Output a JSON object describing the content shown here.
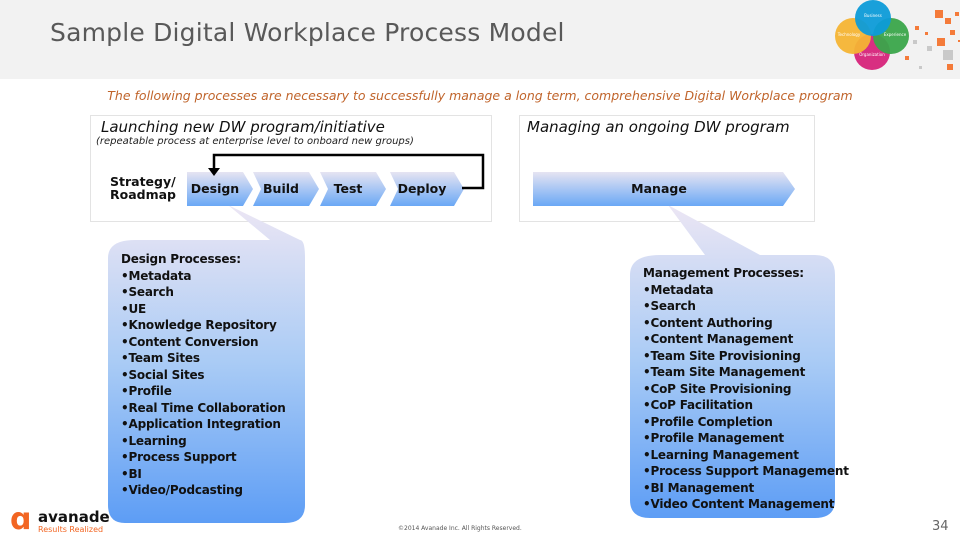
{
  "header": {
    "title": "Sample Digital Workplace Process Model",
    "venn_labels": [
      "Business",
      "Technology",
      "Experience",
      "Organization"
    ]
  },
  "subtitle": "The following processes are necessary to successfully manage a long term, comprehensive Digital Workplace program",
  "launch_panel": {
    "title": "Launching new DW program/initiative",
    "subtitle": "(repeatable process at enterprise level to onboard new groups)",
    "strategy_line1": "Strategy/",
    "strategy_line2": "Roadmap",
    "steps": [
      "Design",
      "Build",
      "Test",
      "Deploy"
    ]
  },
  "manage_panel": {
    "title": "Managing an ongoing DW program",
    "step": "Manage"
  },
  "design_callout": {
    "heading": "Design Processes:",
    "items": [
      "Metadata",
      "Search",
      "UE",
      "Knowledge Repository",
      "Content Conversion",
      "Team Sites",
      "Social Sites",
      "Profile",
      "Real Time Collaboration",
      "Application Integration",
      "Learning",
      "Process Support",
      "BI",
      "Video/Podcasting"
    ]
  },
  "manage_callout": {
    "heading": "Management Processes:",
    "items": [
      "Metadata",
      "Search",
      "Content Authoring",
      "Content Management",
      "Team Site Provisioning",
      "Team Site Management",
      "CoP Site Provisioning",
      "CoP Facilitation",
      "Profile Completion",
      "Profile Management",
      "Learning Management",
      "Process Support Management",
      "BI Management",
      "Video Content Management"
    ]
  },
  "footer": {
    "logo_name": "avanade",
    "logo_tagline": "Results Realized",
    "copyright": "©2014 Avanade Inc. All Rights Reserved.",
    "page_number": "34"
  },
  "colors": {
    "accent_orange": "#c0642b",
    "chevron_top": "#e6e4f2",
    "chevron_bottom": "#6aa8f5",
    "brand_orange": "#f26522"
  }
}
